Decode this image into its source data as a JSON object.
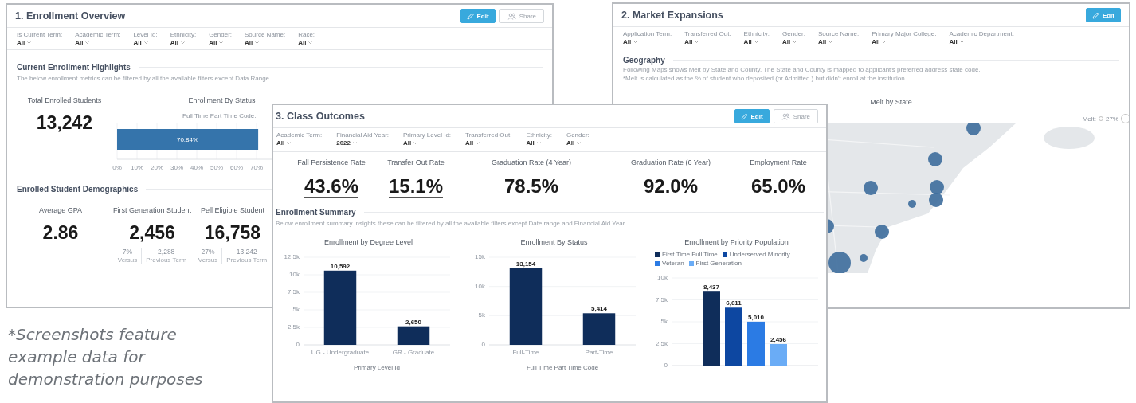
{
  "windows": [
    {
      "kind": "overview",
      "title": "1. Enrollment Overview",
      "buttons": [
        {
          "kind": "edit",
          "label": "Edit"
        },
        {
          "kind": "share",
          "label": "Share"
        }
      ],
      "filters": [
        {
          "label": "Is Current Term:",
          "value": "All"
        },
        {
          "label": "Academic Term:",
          "value": "All"
        },
        {
          "label": "Level Id:",
          "value": "All"
        },
        {
          "label": "Ethnicity:",
          "value": "All"
        },
        {
          "label": "Gender:",
          "value": "All"
        },
        {
          "label": "Source Name:",
          "value": "All"
        },
        {
          "label": "Race:",
          "value": "All"
        }
      ],
      "highlights": {
        "heading": "Current Enrollment Highlights",
        "description": "The below enrollment metrics can be filtered by all the available filters except Data Range.",
        "total": {
          "label": "Total Enrolled Students",
          "value": "13,242"
        },
        "status": {
          "legend_title": "Full Time Part Time Code:",
          "chart_data": {
            "type": "bar",
            "title": "Enrollment By Status",
            "orientation": "horizontal",
            "grid": true,
            "values": [
              70.84
            ],
            "xlim": [
              0,
              100
            ],
            "xticks": [
              {
                "value": 0,
                "label": "0%"
              },
              {
                "value": 10,
                "label": "10%"
              },
              {
                "value": 20,
                "label": "20%"
              },
              {
                "value": 30,
                "label": "30%"
              },
              {
                "value": 40,
                "label": "40%"
              },
              {
                "value": 50,
                "label": "50%"
              },
              {
                "value": 60,
                "label": "60%"
              },
              {
                "value": 70,
                "label": "70%"
              }
            ],
            "value_labels": [
              "70.84%"
            ]
          }
        }
      },
      "demographics": {
        "heading": "Enrolled Student Demographics",
        "metrics": [
          {
            "label": "Average GPA",
            "value": "2.86"
          },
          {
            "label": "First Generation Student",
            "value": "2,456",
            "comparisons": [
              {
                "value": "7%",
                "caption": "Versus"
              },
              {
                "value": "2,288",
                "caption": "Previous Term"
              }
            ]
          },
          {
            "label": "Pell Eligible Student",
            "value": "16,758",
            "comparisons": [
              {
                "value": "27%",
                "caption": "Versus"
              },
              {
                "value": "13,242",
                "caption": "Previous Term"
              }
            ]
          }
        ]
      }
    },
    {
      "kind": "market",
      "title": "2. Market Expansions",
      "buttons": [
        {
          "kind": "edit",
          "label": "Edit"
        }
      ],
      "filters": [
        {
          "label": "Application Term:",
          "value": "All"
        },
        {
          "label": "Transferred Out:",
          "value": "All"
        },
        {
          "label": "Ethnicity:",
          "value": "All"
        },
        {
          "label": "Gender:",
          "value": "All"
        },
        {
          "label": "Source Name:",
          "value": "All"
        },
        {
          "label": "Primary Major College:",
          "value": "All"
        },
        {
          "label": "Academic Department:",
          "value": "All"
        }
      ],
      "geography": {
        "heading": "Geography",
        "description": [
          "Following Maps shows Melt by State and County. The State and County is mapped to applicant's preferred address state code.",
          "*Melt is calculated as the % of student who deposited (or Admitted ) but didn't enroll at the institution."
        ],
        "map": {
          "title": "Melt by State",
          "legend_label": "Melt:",
          "legend_value": "27%"
        }
      }
    },
    {
      "kind": "outcomes",
      "title": "3. Class Outcomes",
      "buttons": [
        {
          "kind": "edit",
          "label": "Edit"
        },
        {
          "kind": "share",
          "label": "Share"
        }
      ],
      "filters": [
        {
          "label": "Academic Term:",
          "value": "All"
        },
        {
          "label": "Financial Aid Year:",
          "value": "2022"
        },
        {
          "label": "Primary Level Id:",
          "value": "All"
        },
        {
          "label": "Transferred Out:",
          "value": "All"
        },
        {
          "label": "Ethnicity:",
          "value": "All"
        },
        {
          "label": "Gender:",
          "value": "All"
        }
      ],
      "kpis": [
        {
          "label": "Fall Persistence Rate",
          "value": "43.6%",
          "linked": true
        },
        {
          "label": "Transfer Out Rate",
          "value": "15.1%",
          "linked": true
        },
        {
          "label": "Graduation Rate (4 Year)",
          "value": "78.5%",
          "linked": false
        },
        {
          "label": "Graduation Rate (6 Year)",
          "value": "92.0%",
          "linked": false
        },
        {
          "label": "Employment Rate",
          "value": "65.0%",
          "linked": false
        }
      ],
      "summary": {
        "heading": "Enrollment Summary",
        "description": "Below enrollment summary insights these can be filtered by all the available filters except Date range and Financial Aid Year.",
        "charts": [
          {
            "chart_data": {
              "type": "bar",
              "title": "Enrollment by Degree Level",
              "xlabel": "Primary Level Id",
              "categories": [
                "UG - Undergraduate",
                "GR - Graduate"
              ],
              "grid": true,
              "values": [
                10592,
                2650
              ],
              "ylim": [
                0,
                12500
              ],
              "yticks": [
                {
                  "value": 0,
                  "label": "0"
                },
                {
                  "value": 2500,
                  "label": "2.5k"
                },
                {
                  "value": 5000,
                  "label": "5k"
                },
                {
                  "value": 7500,
                  "label": "7.5k"
                },
                {
                  "value": 10000,
                  "label": "10k"
                },
                {
                  "value": 12500,
                  "label": "12.5k"
                }
              ],
              "value_labels": [
                "10,592",
                "2,650"
              ]
            }
          },
          {
            "chart_data": {
              "type": "bar",
              "title": "Enrollment By Status",
              "xlabel": "Full Time Part Time Code",
              "categories": [
                "Full-Time",
                "Part-Time"
              ],
              "grid": true,
              "values": [
                13154,
                5414
              ],
              "ylim": [
                0,
                15000
              ],
              "yticks": [
                {
                  "value": 0,
                  "label": "0"
                },
                {
                  "value": 5000,
                  "label": "5k"
                },
                {
                  "value": 10000,
                  "label": "10k"
                },
                {
                  "value": 15000,
                  "label": "15k"
                }
              ],
              "value_labels": [
                "13,154",
                "5,414"
              ]
            }
          },
          {
            "chart_data": {
              "type": "bar",
              "title": "Enrollment by Priority Population",
              "grid": true,
              "legend": "top",
              "series": [
                {
                  "name": "First Time Full Time",
                  "color": "#0f2d5a",
                  "values": [
                    8437
                  ]
                },
                {
                  "name": "Underserved Minority",
                  "color": "#0d47a1",
                  "values": [
                    6611
                  ]
                },
                {
                  "name": "Veteran",
                  "color": "#2b7be4",
                  "values": [
                    5010
                  ]
                },
                {
                  "name": "First Generation",
                  "color": "#6aacf6",
                  "values": [
                    2456
                  ]
                }
              ],
              "ylim": [
                0,
                10000
              ],
              "yticks": [
                {
                  "value": 0,
                  "label": "0"
                },
                {
                  "value": 2500,
                  "label": "2.5k"
                },
                {
                  "value": 5000,
                  "label": "5k"
                },
                {
                  "value": 7500,
                  "label": "7.5k"
                },
                {
                  "value": 10000,
                  "label": "10k"
                }
              ],
              "value_labels": [
                "8,437",
                "6,611",
                "5,010",
                "2,456"
              ]
            }
          }
        ]
      }
    }
  ],
  "caption": "*Screenshots feature example data for demonstration purposes"
}
